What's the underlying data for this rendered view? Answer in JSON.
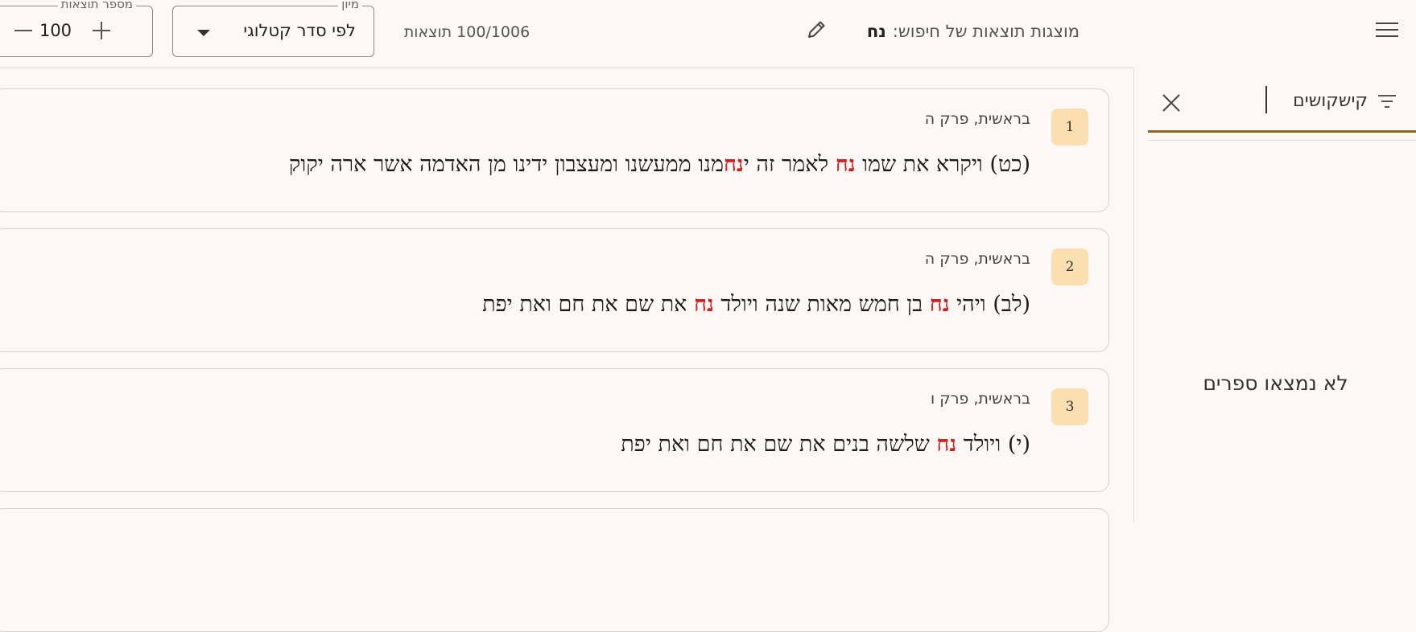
{
  "header": {
    "search_prefix": "מוצגות תוצאות של חיפוש:",
    "search_term": "נח",
    "results_count": "100/1006 תוצאות",
    "sort": {
      "legend": "מיון",
      "value": "לפי סדר קטלוגי"
    },
    "num_results": {
      "legend": "מספר תוצאות",
      "value": "100"
    }
  },
  "sidebar": {
    "filter_text": "קישקושים",
    "empty_message": "לא נמצאו ספרים"
  },
  "results": [
    {
      "number": "1",
      "ref": "בראשית, פרק ה",
      "parts": [
        "(כט) ויקרא את שמו ",
        "נח",
        " לאמר זה י",
        "נח",
        "מנו ממעשנו ומעצבון ידינו מן האדמה אשר ארה יקוק"
      ]
    },
    {
      "number": "2",
      "ref": "בראשית, פרק ה",
      "parts": [
        "(לב) ויהי ",
        "נח",
        " בן חמש מאות שנה ויולד ",
        "נח",
        " את שם את חם ואת יפת"
      ]
    },
    {
      "number": "3",
      "ref": "בראשית, פרק ו",
      "parts": [
        "(י) ויולד ",
        "נח",
        " שלשה בנים את שם את חם ואת יפת"
      ]
    }
  ]
}
